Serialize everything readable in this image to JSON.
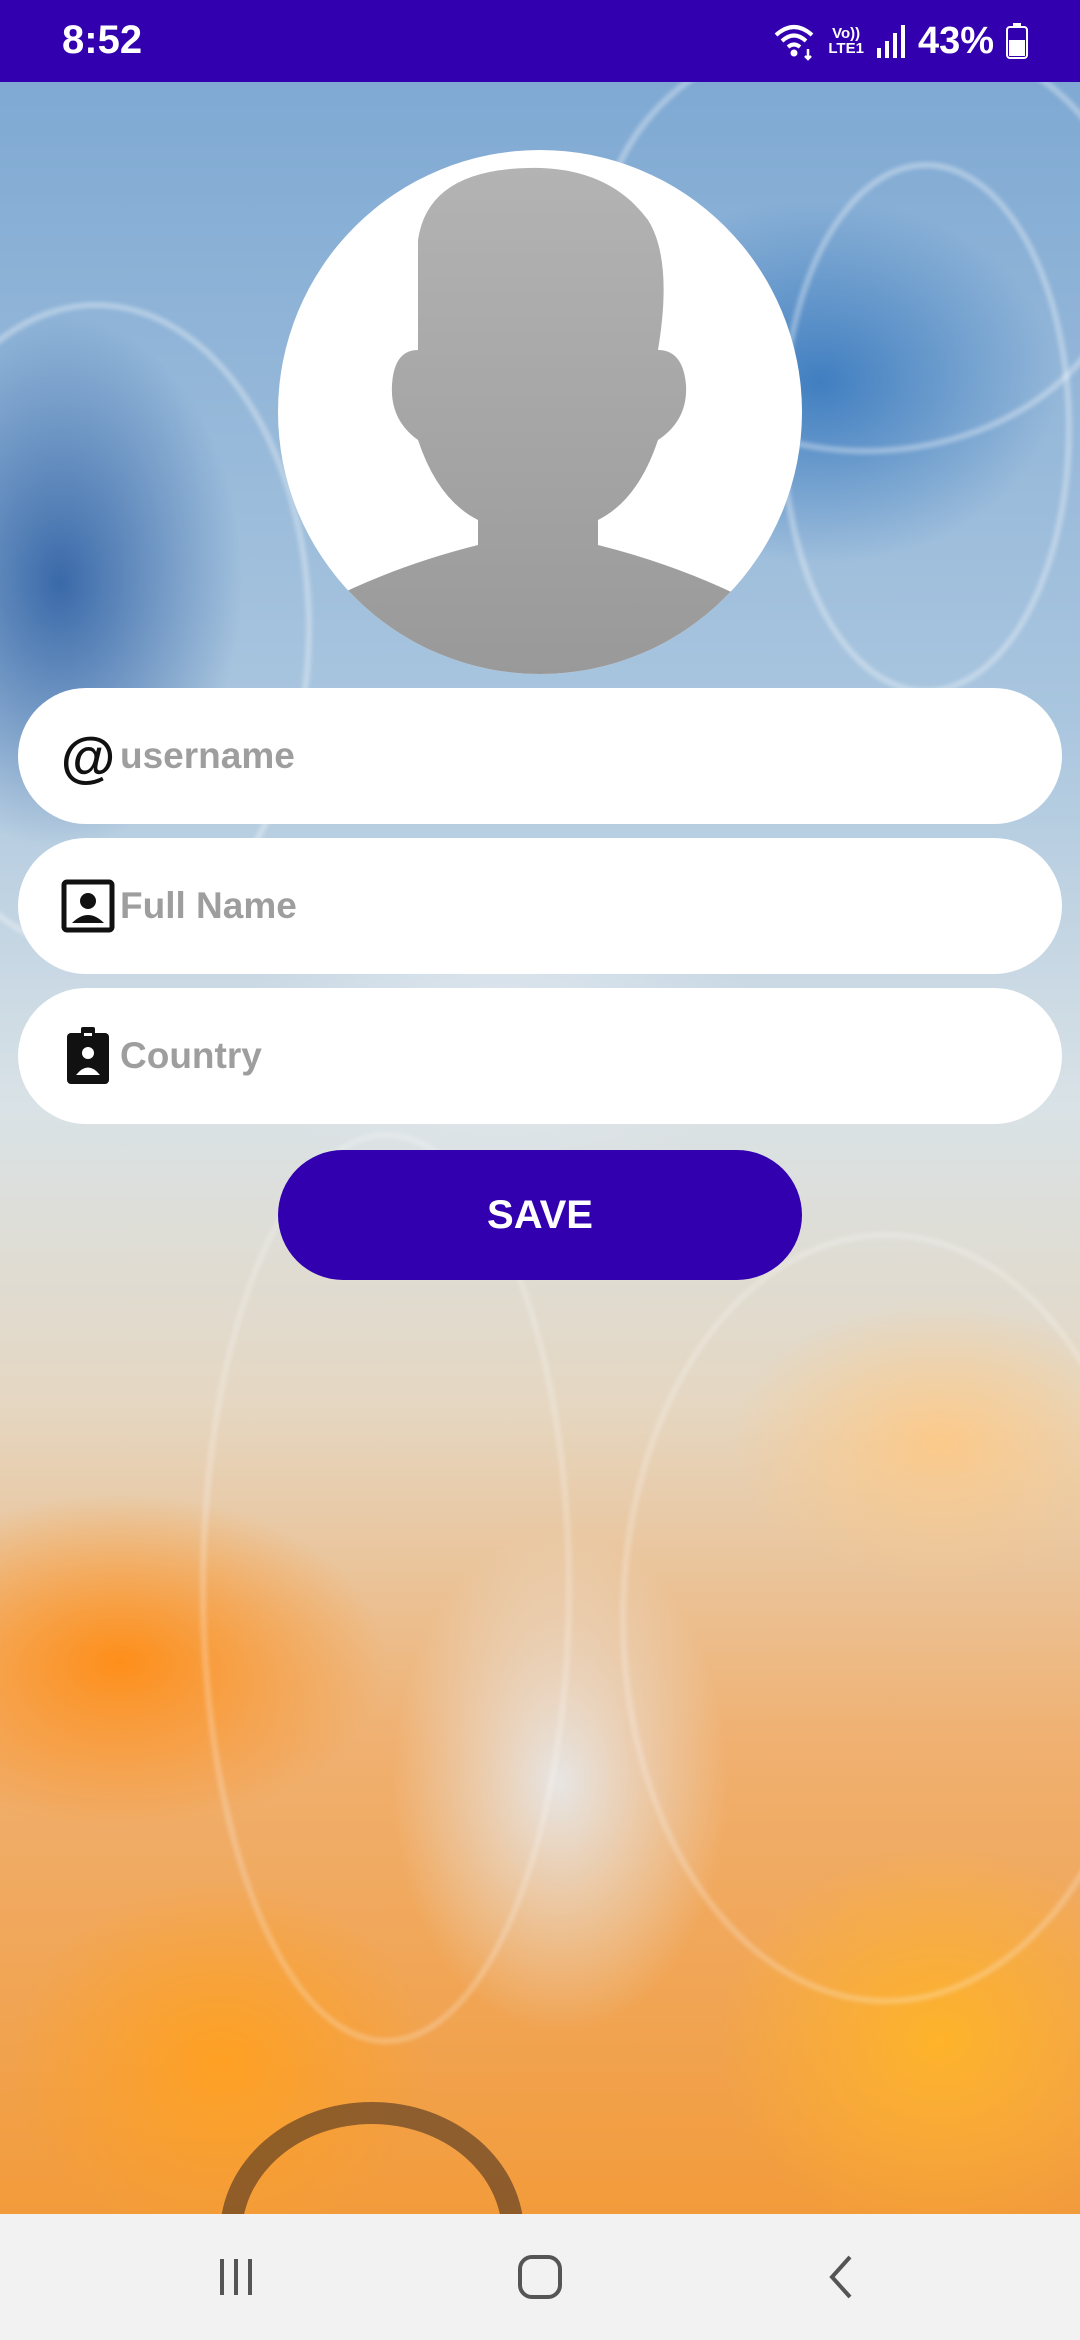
{
  "status_bar": {
    "time": "8:52",
    "network_label_top": "Vo))",
    "network_label_bottom": "LTE1",
    "battery": "43%"
  },
  "form": {
    "username_placeholder": "username",
    "fullname_placeholder": "Full Name",
    "country_placeholder": "Country",
    "save_label": "SAVE"
  },
  "colors": {
    "primary": "#3300b0",
    "field_background": "#ffffff",
    "placeholder": "#9e9e9e",
    "avatar_silhouette": "#a6a6a6"
  },
  "icons": {
    "username": "at-sign-icon",
    "fullname": "contact-card-icon",
    "country": "id-badge-icon",
    "avatar": "person-silhouette-icon"
  },
  "nav": {
    "recents": "recents-icon",
    "home": "home-icon",
    "back": "back-icon"
  }
}
